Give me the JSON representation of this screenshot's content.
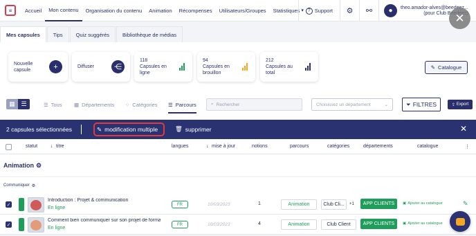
{
  "nav": {
    "items": [
      "Accueil",
      "Mon contenu",
      "Organisation du contenu",
      "Animation",
      "Récompenses",
      "Utilisateurs/Groupes",
      "Statistiques"
    ],
    "support_label": "Support",
    "user_email": "theo.amador-alves@beedeez...",
    "user_org": "(pour Club Beedeez)"
  },
  "tabs": [
    "Mes capsules",
    "Tips",
    "Quiz suggérés",
    "Bibliothèque de médias"
  ],
  "cards": {
    "new_capsule": "Nouvelle capsule",
    "broadcast": "Diffuser",
    "online_count": "118",
    "online_label": "Capsules en ligne",
    "draft_count": "94",
    "draft_label": "Capsules en brouillon",
    "total_count": "212",
    "total_label": "Capsules au total",
    "catalog_button": "Catalogue"
  },
  "toolbar": {
    "filters": [
      "Tous",
      "Départements",
      "Catégories",
      "Parcours"
    ],
    "search_placeholder": "Rechercher",
    "department_placeholder": "Choisissez un département",
    "filters_button": "FILTRES",
    "export_button": "Export"
  },
  "selection": {
    "count_text": "2 capsules sélectionnées",
    "multi_edit": "modification multiple",
    "delete": "supprimer"
  },
  "table": {
    "headers": {
      "status": "statut",
      "title": "titre",
      "languages": "langues",
      "updated": "mise à jour",
      "notes": "notions",
      "paths": "parcours",
      "categories": "catégories",
      "departments": "départements",
      "catalog": "catalogue"
    },
    "group": "Animation",
    "subgroup": "Communiquer",
    "rows": [
      {
        "title": "Introduction : Projet & communication",
        "status": "En ligne",
        "lang": "FR",
        "date": "10/03/2023",
        "notes": "1",
        "path": "Animation",
        "category": "Club Cli...",
        "extra": "+1",
        "department": "APP CLIENTS",
        "catalog": "Ajouter au catalogue"
      },
      {
        "title": "Comment bien communiquer sur son projet de formation",
        "status": "En ligne",
        "lang": "FR",
        "date": "10/03/2023",
        "notes": "4",
        "path": "Animation",
        "category": "Club Client",
        "extra": "",
        "department": "APP CLIENTS",
        "catalog": "Ajouter au catalogue"
      }
    ]
  }
}
